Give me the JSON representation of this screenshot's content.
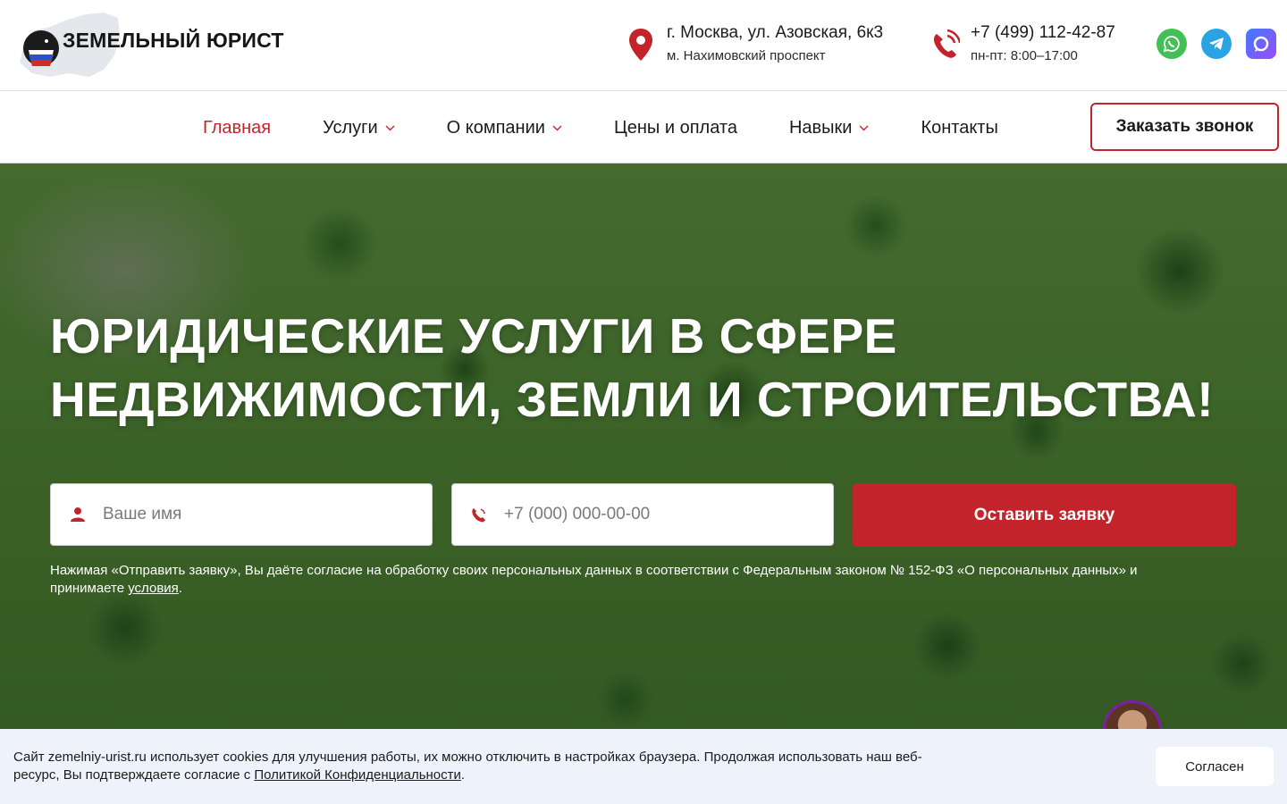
{
  "header": {
    "logo_text": "ЗЕМЕЛЬНЫЙ ЮРИСТ",
    "address_line1": "г. Москва, ул. Азовская, 6к3",
    "address_line2": "м. Нахимовский проспект",
    "phone": "+7 (499) 112-42-87",
    "hours": "пн-пт: 8:00–17:00",
    "socials": [
      {
        "name": "whatsapp-icon"
      },
      {
        "name": "telegram-icon"
      },
      {
        "name": "max-messenger-icon"
      }
    ]
  },
  "nav": {
    "items": [
      {
        "label": "Главная",
        "active": true,
        "dropdown": false
      },
      {
        "label": "Услуги",
        "active": false,
        "dropdown": true
      },
      {
        "label": "О компании",
        "active": false,
        "dropdown": true
      },
      {
        "label": "Цены и оплата",
        "active": false,
        "dropdown": false
      },
      {
        "label": "Навыки",
        "active": false,
        "dropdown": true
      },
      {
        "label": "Контакты",
        "active": false,
        "dropdown": false
      }
    ],
    "cta_label": "Заказать звонок"
  },
  "hero": {
    "title_line1": "ЮРИДИЧЕСКИЕ УСЛУГИ В СФЕРЕ",
    "title_line2": "НЕДВИЖИМОСТИ, ЗЕМЛИ И СТРОИТЕЛЬСТВА!",
    "name_placeholder": "Ваше имя",
    "phone_placeholder": "+7 (000) 000-00-00",
    "submit_label": "Оставить заявку",
    "consent_text": "Нажимая «Отправить заявку», Вы даёте согласие на обработку своих персональных данных в соответствии с Федеральным законом № 152-ФЗ «О персональных данных» и принимаете ",
    "consent_link": "условия",
    "consent_end": "."
  },
  "cookie": {
    "text": "Сайт zemelniy-urist.ru использует cookies для улучшения работы, их можно отключить в настройках браузера. Продолжая использовать наш веб-ресурс, Вы подтверждаете согласие с ",
    "link": "Политикой Конфиденциальности",
    "end": ".",
    "accept_label": "Согласен"
  },
  "colors": {
    "accent": "#c3242b",
    "cookie_bg": "#eef2fa"
  }
}
